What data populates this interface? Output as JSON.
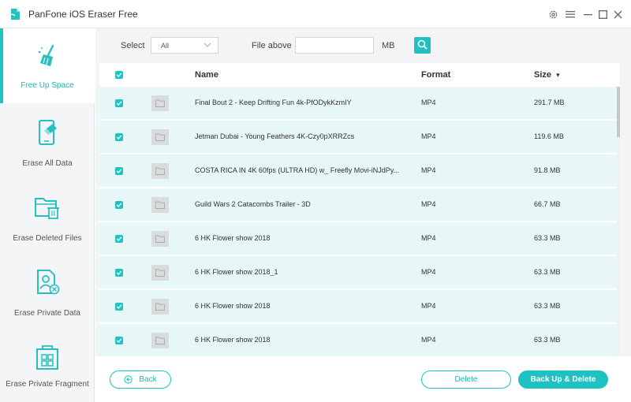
{
  "window": {
    "title": "PanFone iOS Eraser Free",
    "icons": [
      "app-logo-icon",
      "gear-icon",
      "minimize-icon",
      "maximize-icon",
      "close-icon"
    ]
  },
  "sidebar": {
    "items": [
      {
        "label": "Free Up Space",
        "icon": "broom-icon",
        "active": true
      },
      {
        "label": "Erase All Data",
        "icon": "phone-eraser-icon",
        "active": false
      },
      {
        "label": "Erase Deleted Files",
        "icon": "folder-trash-icon",
        "active": false
      },
      {
        "label": "Erase Private Data",
        "icon": "private-file-icon",
        "active": false
      },
      {
        "label": "Erase Private Fragment",
        "icon": "fragment-grid-icon",
        "active": false
      }
    ]
  },
  "toolbar": {
    "select_label": "Select",
    "select_value": "All",
    "file_above_label": "File above",
    "file_above_value": "",
    "unit": "MB"
  },
  "table": {
    "columns": [
      "Name",
      "Format",
      "Size"
    ],
    "sort_indicator": "▾",
    "rows": [
      {
        "name": "Final Bout 2 - Keep Drifting Fun 4k-PfODykKzmIY",
        "format": "MP4",
        "size": "291.7 MB",
        "checked": true
      },
      {
        "name": "Jetman Dubai - Young Feathers 4K-Czy0pXRRZcs",
        "format": "MP4",
        "size": "119.6 MB",
        "checked": true
      },
      {
        "name": "COSTA RICA IN 4K 60fps (ULTRA HD) w_ Freefly Movi-iNJdPy...",
        "format": "MP4",
        "size": "91.8 MB",
        "checked": true
      },
      {
        "name": "Guild Wars 2 Catacombs Trailer - 3D",
        "format": "MP4",
        "size": "66.7 MB",
        "checked": true
      },
      {
        "name": "6 HK Flower show 2018",
        "format": "MP4",
        "size": "63.3 MB",
        "checked": true
      },
      {
        "name": "6 HK Flower show 2018_1",
        "format": "MP4",
        "size": "63.3 MB",
        "checked": true
      },
      {
        "name": "6 HK Flower show 2018",
        "format": "MP4",
        "size": "63.3 MB",
        "checked": true
      },
      {
        "name": "6 HK Flower show 2018",
        "format": "MP4",
        "size": "63.3 MB",
        "checked": true
      }
    ]
  },
  "footer": {
    "back_label": "Back",
    "delete_label": "Delete",
    "backup_delete_label": "Back Up & Delete"
  },
  "colors": {
    "accent": "#1ec2c2",
    "row_bg": "#e7f7f7"
  }
}
